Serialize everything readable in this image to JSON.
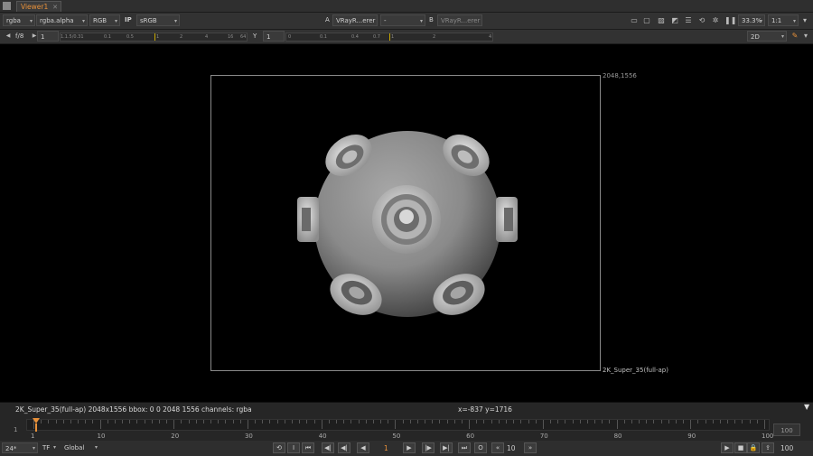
{
  "tabs": [
    {
      "label": "Viewer1"
    }
  ],
  "toolbar1": {
    "channels": "rgba",
    "alpha_channel": "rgba.alpha",
    "display_channel": "RGB",
    "ip_label": "IP",
    "colorspace": "sRGB",
    "input_a_label": "A",
    "input_a_value": "VRayR...erer",
    "compare_mode": "-",
    "input_b_label": "B",
    "input_b_value": "VRayR...erer",
    "zoom": "33.3%",
    "proxy_ratio": "1:1"
  },
  "toolbar2": {
    "fstop": "f/8",
    "gain_value": "1",
    "gain_ticks": [
      "1.1.5/0.31",
      "0.1",
      "0.5",
      "1",
      "2",
      "4",
      "16",
      "64"
    ],
    "gamma_label": "Y",
    "gamma_value": "1",
    "gamma_ticks": [
      "0",
      "0.1",
      "0.4",
      "0.7",
      "1",
      "2",
      "4"
    ],
    "view_mode": "2D"
  },
  "viewer": {
    "resolution_label": "2048,1556",
    "format_label": "2K_Super_35(full-ap)"
  },
  "infobar": {
    "info": "2K_Super_35(full-ap) 2048x1556  bbox: 0 0 2048 1556 channels: rgba",
    "coords": "x=-837 y=1716"
  },
  "timeline": {
    "first_frame": "1",
    "end_frame": "100",
    "labels": [
      "1",
      "10",
      "20",
      "30",
      "40",
      "50",
      "60",
      "70",
      "80",
      "90",
      "100"
    ],
    "current_frame": 1
  },
  "controls": {
    "fps": "24*",
    "tf": "TF",
    "range_mode": "Global",
    "current_frame": "1",
    "skip_increment": "10",
    "last_frame": "100"
  },
  "colors": {
    "accent": "#e8913a",
    "background": "#000000",
    "panel": "#323232"
  }
}
